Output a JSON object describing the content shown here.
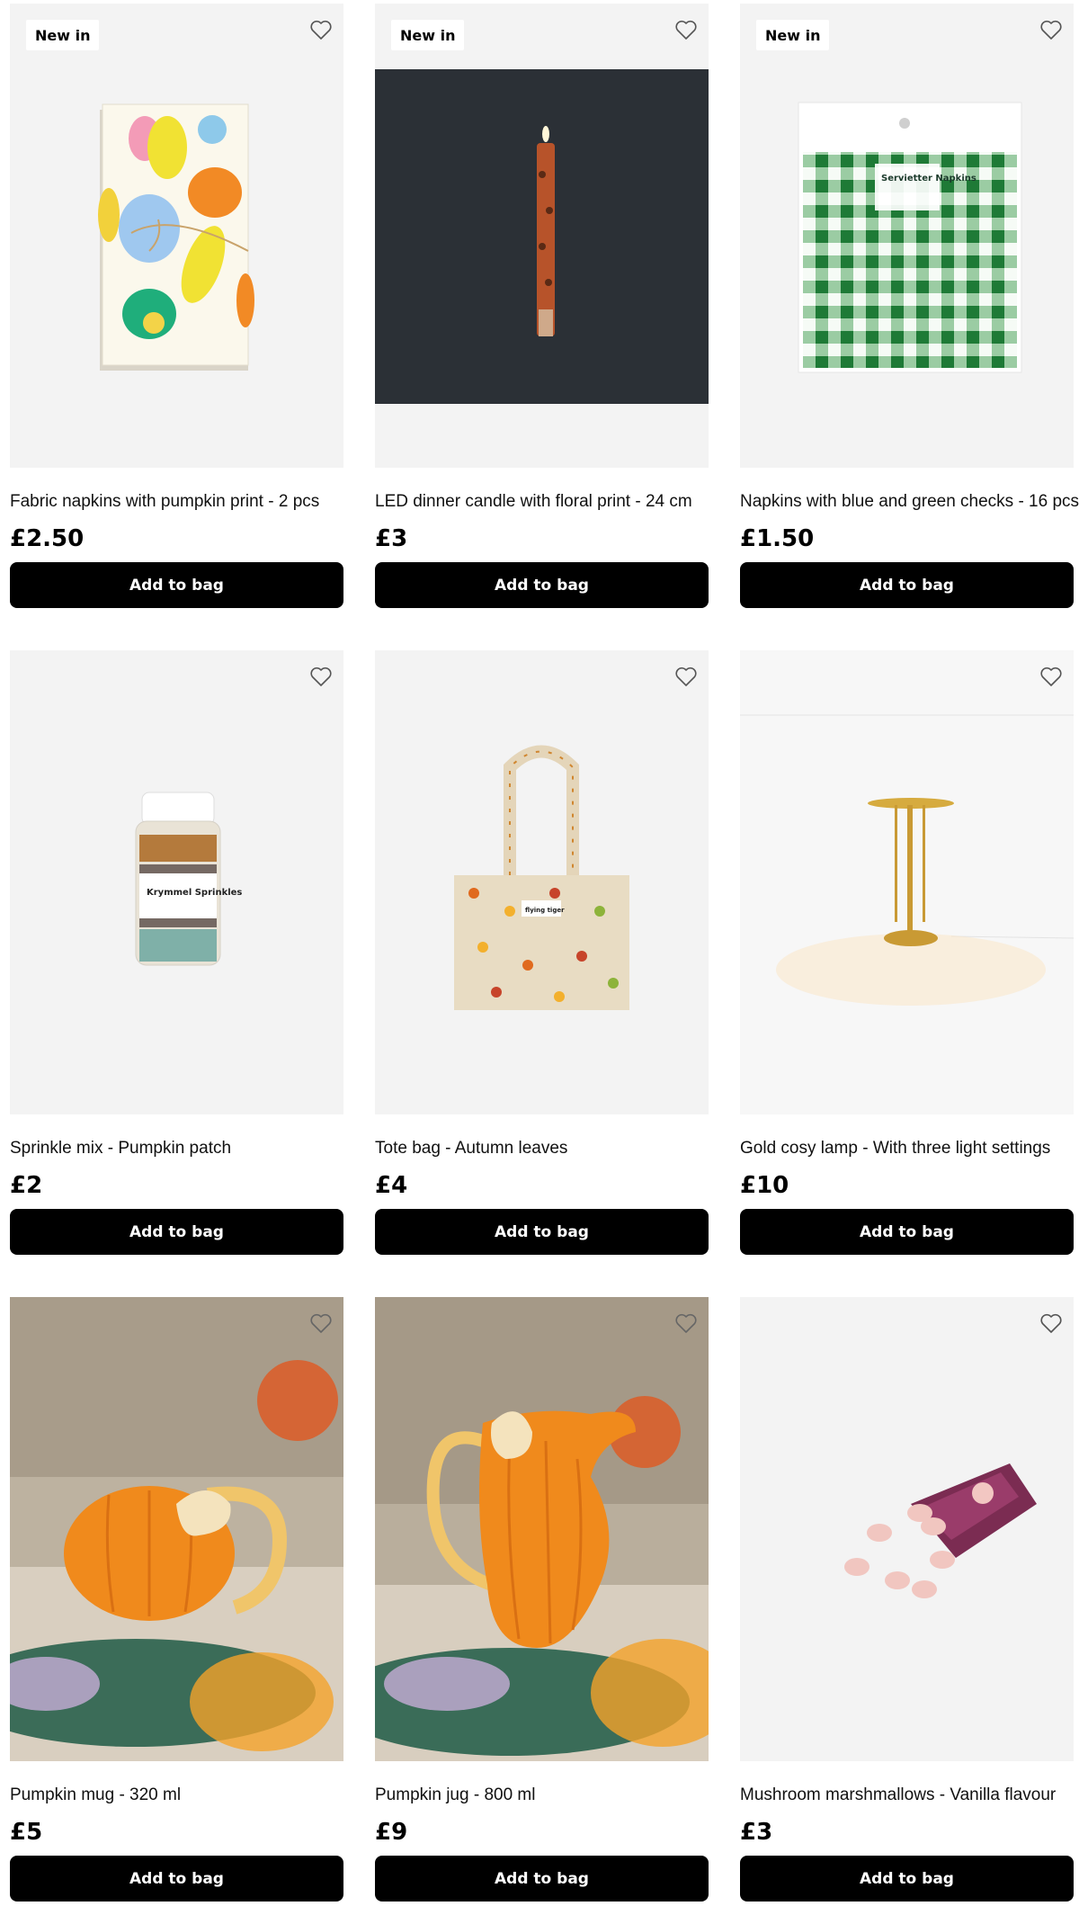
{
  "colors": {
    "tile_bg": "#f3f3f3",
    "button_bg": "#000000",
    "button_text": "#ffffff",
    "badge_bg": "#ffffff"
  },
  "products": [
    {
      "badge": "New in",
      "title": "Fabric napkins with pumpkin print - 2 pcs",
      "price": "£2.50",
      "button": "Add to bag",
      "icon": "heart-outline-icon"
    },
    {
      "badge": "New in",
      "title": "LED dinner candle with floral print - 24 cm",
      "price": "£3",
      "button": "Add to bag",
      "icon": "heart-outline-icon"
    },
    {
      "badge": "New in",
      "title": "Napkins with blue and green checks - 16 pcs",
      "price": "£1.50",
      "button": "Add to bag",
      "icon": "heart-outline-icon"
    },
    {
      "badge": "",
      "title": "Sprinkle mix - Pumpkin patch",
      "price": "£2",
      "button": "Add to bag",
      "icon": "heart-outline-icon"
    },
    {
      "badge": "",
      "title": "Tote bag - Autumn leaves",
      "price": "£4",
      "button": "Add to bag",
      "icon": "heart-outline-icon"
    },
    {
      "badge": "",
      "title": "Gold cosy lamp - With three light settings",
      "price": "£10",
      "button": "Add to bag",
      "icon": "heart-outline-icon"
    },
    {
      "badge": "",
      "title": "Pumpkin mug - 320 ml",
      "price": "£5",
      "button": "Add to bag",
      "icon": "heart-outline-icon"
    },
    {
      "badge": "",
      "title": "Pumpkin jug - 800 ml",
      "price": "£9",
      "button": "Add to bag",
      "icon": "heart-outline-icon"
    },
    {
      "badge": "",
      "title": "Mushroom marshmallows - Vanilla flavour",
      "price": "£3",
      "button": "Add to bag",
      "icon": "heart-outline-icon"
    }
  ],
  "packaging_text": {
    "napkin_pack": "Servietter Napkins",
    "sprinkles_jar": "Krymmel Sprinkles",
    "tote_label": "flying tiger"
  }
}
